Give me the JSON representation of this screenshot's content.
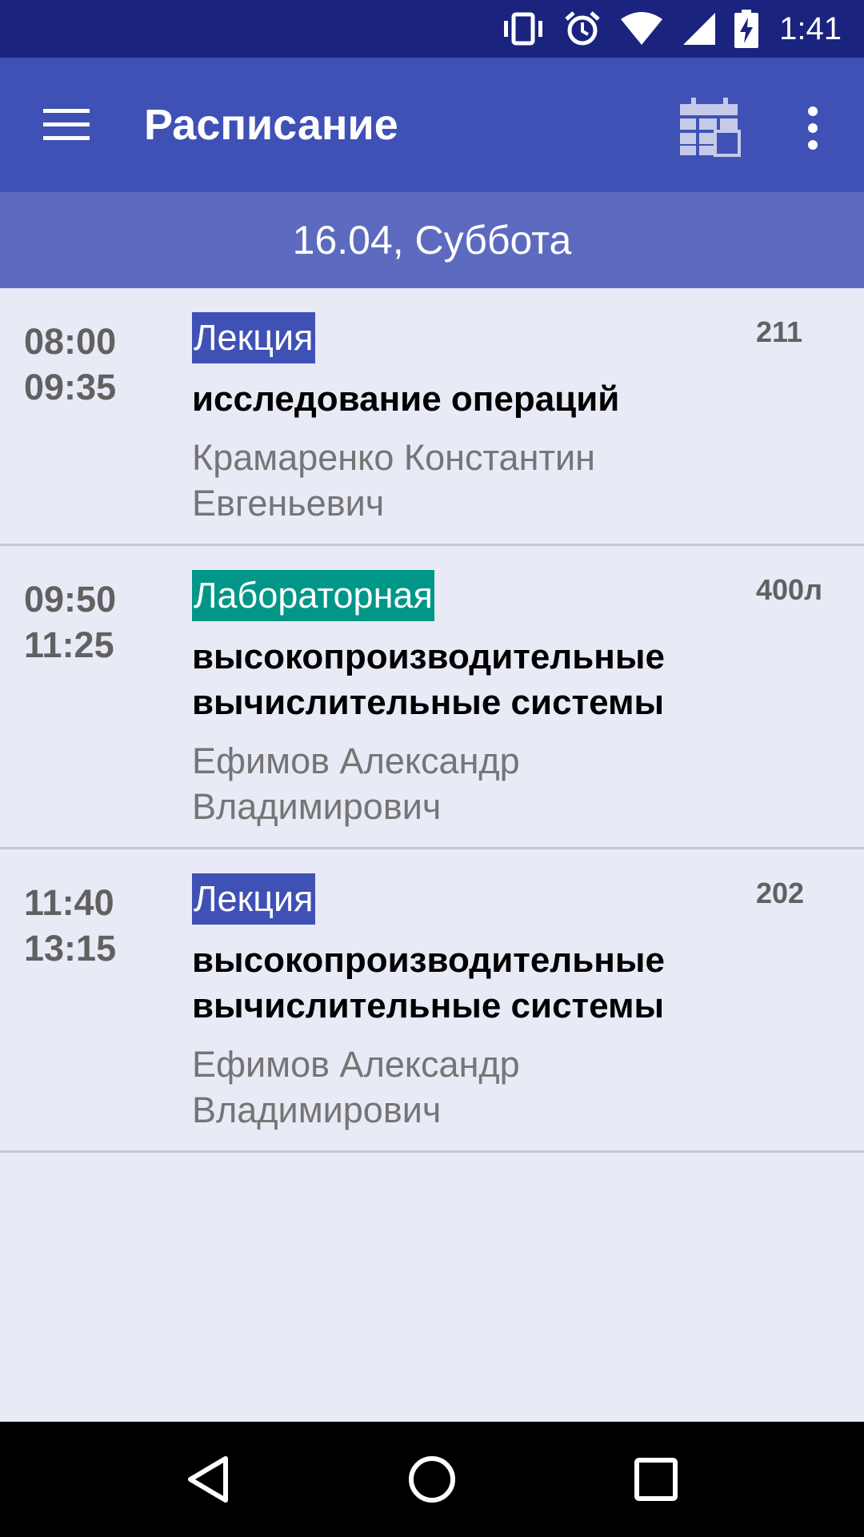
{
  "status_bar": {
    "time": "1:41",
    "icons": [
      "vibrate-icon",
      "alarm-icon",
      "wifi-icon",
      "signal-icon",
      "battery-charging-icon"
    ]
  },
  "app_bar": {
    "title": "Расписание",
    "menu_icon": "hamburger-menu-icon",
    "calendar_icon": "calendar-icon",
    "more_icon": "more-vert-icon"
  },
  "date_header": "16.04, Суббота",
  "lessons": [
    {
      "start": "08:00",
      "end": "09:35",
      "type": "Лекция",
      "subject": "исследование операций",
      "teacher": "Крамаренко Константин Евгеньевич",
      "room": "211"
    },
    {
      "start": "09:50",
      "end": "11:25",
      "type": "Лабораторная",
      "subject": "высокопроизводительные вычислительные системы",
      "teacher": "Ефимов Александр Владимирович",
      "room": "400л"
    },
    {
      "start": "11:40",
      "end": "13:15",
      "type": "Лекция",
      "subject": "высокопроизводительные вычислительные системы",
      "teacher": "Ефимов Александр Владимирович",
      "room": "202"
    }
  ],
  "colors": {
    "status_bar": "#1a237e",
    "app_bar": "#3f51b5",
    "date_header": "#5c6bc0",
    "background": "#e8eaf6",
    "lecture_badge": "#3f51b5",
    "lab_badge": "#009688"
  },
  "nav_bar": {
    "icons": [
      "back-icon",
      "home-icon",
      "recents-icon"
    ]
  }
}
